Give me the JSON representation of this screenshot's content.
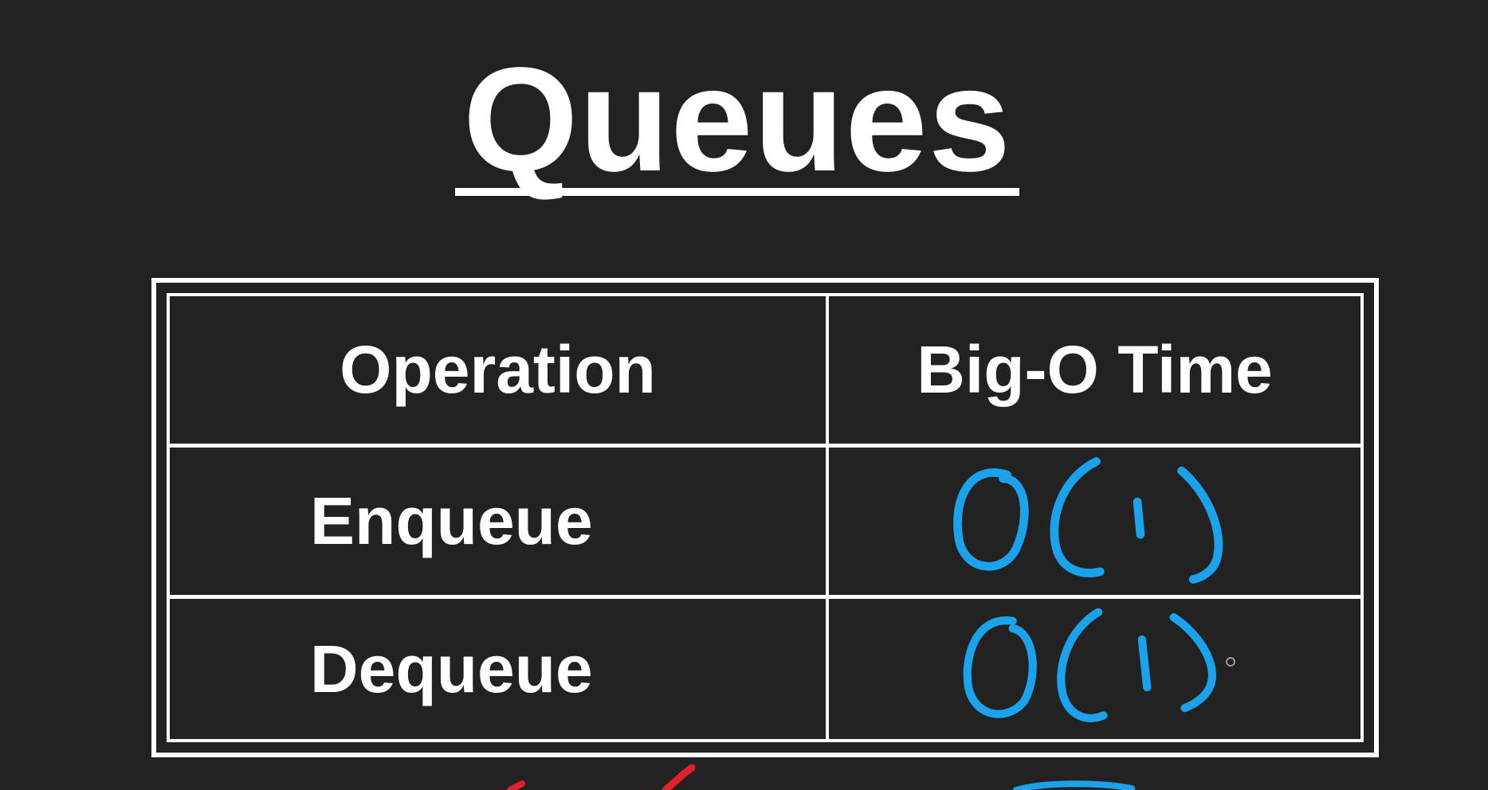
{
  "slide": {
    "title": "Queues"
  },
  "table": {
    "headers": [
      "Operation",
      "Big-O Time"
    ],
    "rows": [
      {
        "operation": "Enqueue",
        "time": "O(1)"
      },
      {
        "operation": "Dequeue",
        "time": "O(1)"
      }
    ]
  },
  "colors": {
    "background": "#222222",
    "text": "#ffffff",
    "handwriting": "#1aa3ec",
    "annotation_red": "#e0202a"
  }
}
